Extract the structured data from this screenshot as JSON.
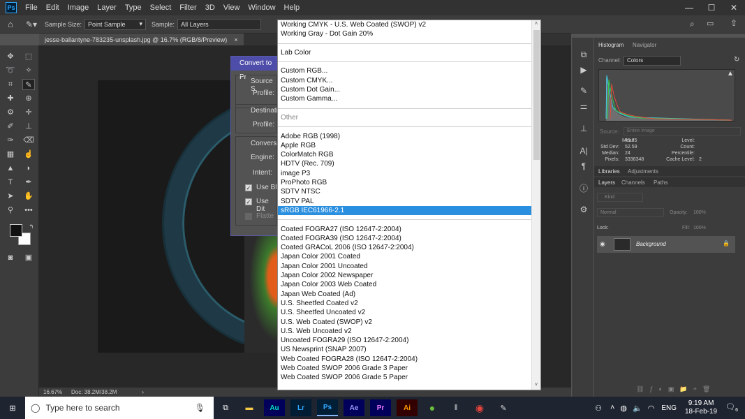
{
  "menubar": {
    "logo": "Ps",
    "items": [
      "File",
      "Edit",
      "Image",
      "Layer",
      "Type",
      "Select",
      "Filter",
      "3D",
      "View",
      "Window",
      "Help"
    ],
    "window_controls": [
      "—",
      "☐",
      "✕"
    ]
  },
  "options_bar": {
    "sample_size_label": "Sample Size:",
    "sample_size_value": "Point Sample",
    "sample_label": "Sample:",
    "sample_value": "All Layers"
  },
  "document": {
    "tab_title": "jesse-ballantyne-783235-unsplash.jpg @ 16.7% (RGB/8/Preview)",
    "zoom": "16.67%",
    "doc_size": "Doc: 38.2M/38.2M"
  },
  "dialog": {
    "title": "Convert to Pr",
    "source_label": "Source S",
    "profile_label_1": "Profile:",
    "destination_label": "Destinati",
    "profile_label_2": "Profile:",
    "conversion_label": "Conversi",
    "engine_label": "Engine:",
    "intent_label": "Intent:",
    "use_black_label": "Use Bl",
    "use_dither_label": "Use Dit",
    "flatten_label": "Flatte"
  },
  "dropdown": {
    "items": [
      {
        "label": "Working CMYK - U.S. Web Coated (SWOP) v2",
        "kind": "item"
      },
      {
        "label": "Working Gray - Dot Gain 20%",
        "kind": "item"
      },
      {
        "label": "",
        "kind": "sep"
      },
      {
        "label": "Lab Color",
        "kind": "item"
      },
      {
        "label": "",
        "kind": "sep"
      },
      {
        "label": "Custom RGB...",
        "kind": "item"
      },
      {
        "label": "Custom CMYK...",
        "kind": "item"
      },
      {
        "label": "Custom Dot Gain...",
        "kind": "item"
      },
      {
        "label": "Custom Gamma...",
        "kind": "item"
      },
      {
        "label": "",
        "kind": "sep"
      },
      {
        "label": "Other",
        "kind": "dim"
      },
      {
        "label": "",
        "kind": "sep"
      },
      {
        "label": "Adobe RGB (1998)",
        "kind": "item"
      },
      {
        "label": "Apple RGB",
        "kind": "item"
      },
      {
        "label": "ColorMatch RGB",
        "kind": "item"
      },
      {
        "label": "HDTV (Rec. 709)",
        "kind": "item"
      },
      {
        "label": "image P3",
        "kind": "item"
      },
      {
        "label": "ProPhoto RGB",
        "kind": "item"
      },
      {
        "label": "SDTV NTSC",
        "kind": "item"
      },
      {
        "label": "SDTV PAL",
        "kind": "item"
      },
      {
        "label": "sRGB IEC61966-2.1",
        "kind": "sel"
      },
      {
        "label": "",
        "kind": "sep"
      },
      {
        "label": "Coated FOGRA27 (ISO 12647-2:2004)",
        "kind": "item"
      },
      {
        "label": "Coated FOGRA39 (ISO 12647-2:2004)",
        "kind": "item"
      },
      {
        "label": "Coated GRACoL 2006 (ISO 12647-2:2004)",
        "kind": "item"
      },
      {
        "label": "Japan Color 2001 Coated",
        "kind": "item"
      },
      {
        "label": "Japan Color 2001 Uncoated",
        "kind": "item"
      },
      {
        "label": "Japan Color 2002 Newspaper",
        "kind": "item"
      },
      {
        "label": "Japan Color 2003 Web Coated",
        "kind": "item"
      },
      {
        "label": "Japan Web Coated (Ad)",
        "kind": "item"
      },
      {
        "label": "U.S. Sheetfed Coated v2",
        "kind": "item"
      },
      {
        "label": "U.S. Sheetfed Uncoated v2",
        "kind": "item"
      },
      {
        "label": "U.S. Web Coated (SWOP) v2",
        "kind": "item"
      },
      {
        "label": "U.S. Web Uncoated v2",
        "kind": "item"
      },
      {
        "label": "Uncoated FOGRA29 (ISO 12647-2:2004)",
        "kind": "item"
      },
      {
        "label": "US Newsprint (SNAP 2007)",
        "kind": "item"
      },
      {
        "label": "Web Coated FOGRA28 (ISO 12647-2:2004)",
        "kind": "item"
      },
      {
        "label": "Web Coated SWOP 2006 Grade 3 Paper",
        "kind": "item"
      },
      {
        "label": "Web Coated SWOP 2006 Grade 5 Paper",
        "kind": "item"
      }
    ]
  },
  "panels": {
    "tab_histogram": "Histogram",
    "tab_navigator": "Navigator",
    "channel_label": "Channel:",
    "channel_value": "Colors",
    "source_label": "Source:",
    "source_value": "Entire Image",
    "stats": {
      "mean_label": "Mean:",
      "mean": "45.75",
      "stddev_label": "Std Dev:",
      "stddev": "52.59",
      "median_label": "Median:",
      "median": "24",
      "pixels_label": "Pixels:",
      "pixels": "3338348",
      "level_label": "Level:",
      "count_label": "Count:",
      "percentile_label": "Percentile:",
      "cache_label": "Cache Level:",
      "cache": "2"
    },
    "tab_libraries": "Libraries",
    "tab_adjustments": "Adjustments",
    "tab_layers": "Layers",
    "tab_channels": "Channels",
    "tab_paths": "Paths",
    "kind_label": "Kind",
    "blend_mode": "Normal",
    "opacity_label": "Opacity:",
    "opacity_value": "100%",
    "lock_label": "Lock:",
    "fill_label": "Fill:",
    "fill_value": "100%",
    "layer_name": "Background"
  },
  "taskbar": {
    "search_placeholder": "Type here to search",
    "apps": [
      "Au",
      "Lr",
      "Ps",
      "Ae",
      "Pr",
      "Ai"
    ],
    "lang": "ENG",
    "time": "9:19 AM",
    "date": "18-Feb-19",
    "notif_count": "6"
  },
  "colors": {
    "menubar_bg": "#323232",
    "panel_bg": "#3c3c3c",
    "selection": "#2b8fe0",
    "dialog_title": "#4e4eaa"
  }
}
